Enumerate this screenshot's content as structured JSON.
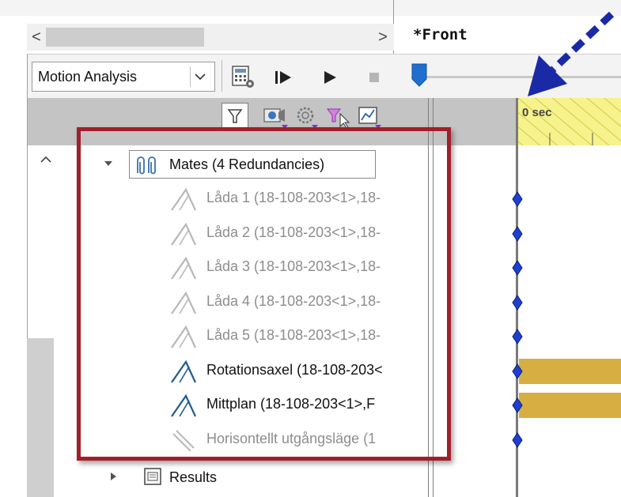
{
  "header": {
    "view_tab": "*Front"
  },
  "scroll": {
    "left_arrow": "<",
    "right_arrow": ">"
  },
  "toolbar": {
    "study_type": "Motion Analysis",
    "slider_fraction": 0.0
  },
  "timeline": {
    "time_label": "0 sec",
    "accent_color": "#f6f28c",
    "bar_color": "#d6ae42",
    "key_color": "#1f3fd0"
  },
  "tree": {
    "mates": {
      "label": "Mates (4 Redundancies)",
      "items": [
        {
          "label": "Låda 1 (18-108-203<1>,18-",
          "state": "redundant"
        },
        {
          "label": "Låda 2 (18-108-203<1>,18-",
          "state": "redundant"
        },
        {
          "label": "Låda 3 (18-108-203<1>,18-",
          "state": "redundant"
        },
        {
          "label": "Låda 4 (18-108-203<1>,18-",
          "state": "redundant"
        },
        {
          "label": "Låda 5 (18-108-203<1>,18-",
          "state": "redundant"
        },
        {
          "label": "Rotationsaxel (18-108-203<",
          "state": "active"
        },
        {
          "label": "Mittplan (18-108-203<1>,F",
          "state": "active"
        },
        {
          "label": "Horisontellt utgångsläge (1",
          "state": "suppressed"
        }
      ]
    },
    "results": {
      "label": "Results"
    }
  },
  "annotation": {
    "highlight_color": "#a11f2b",
    "arrow_color": "#1a2aa6"
  }
}
